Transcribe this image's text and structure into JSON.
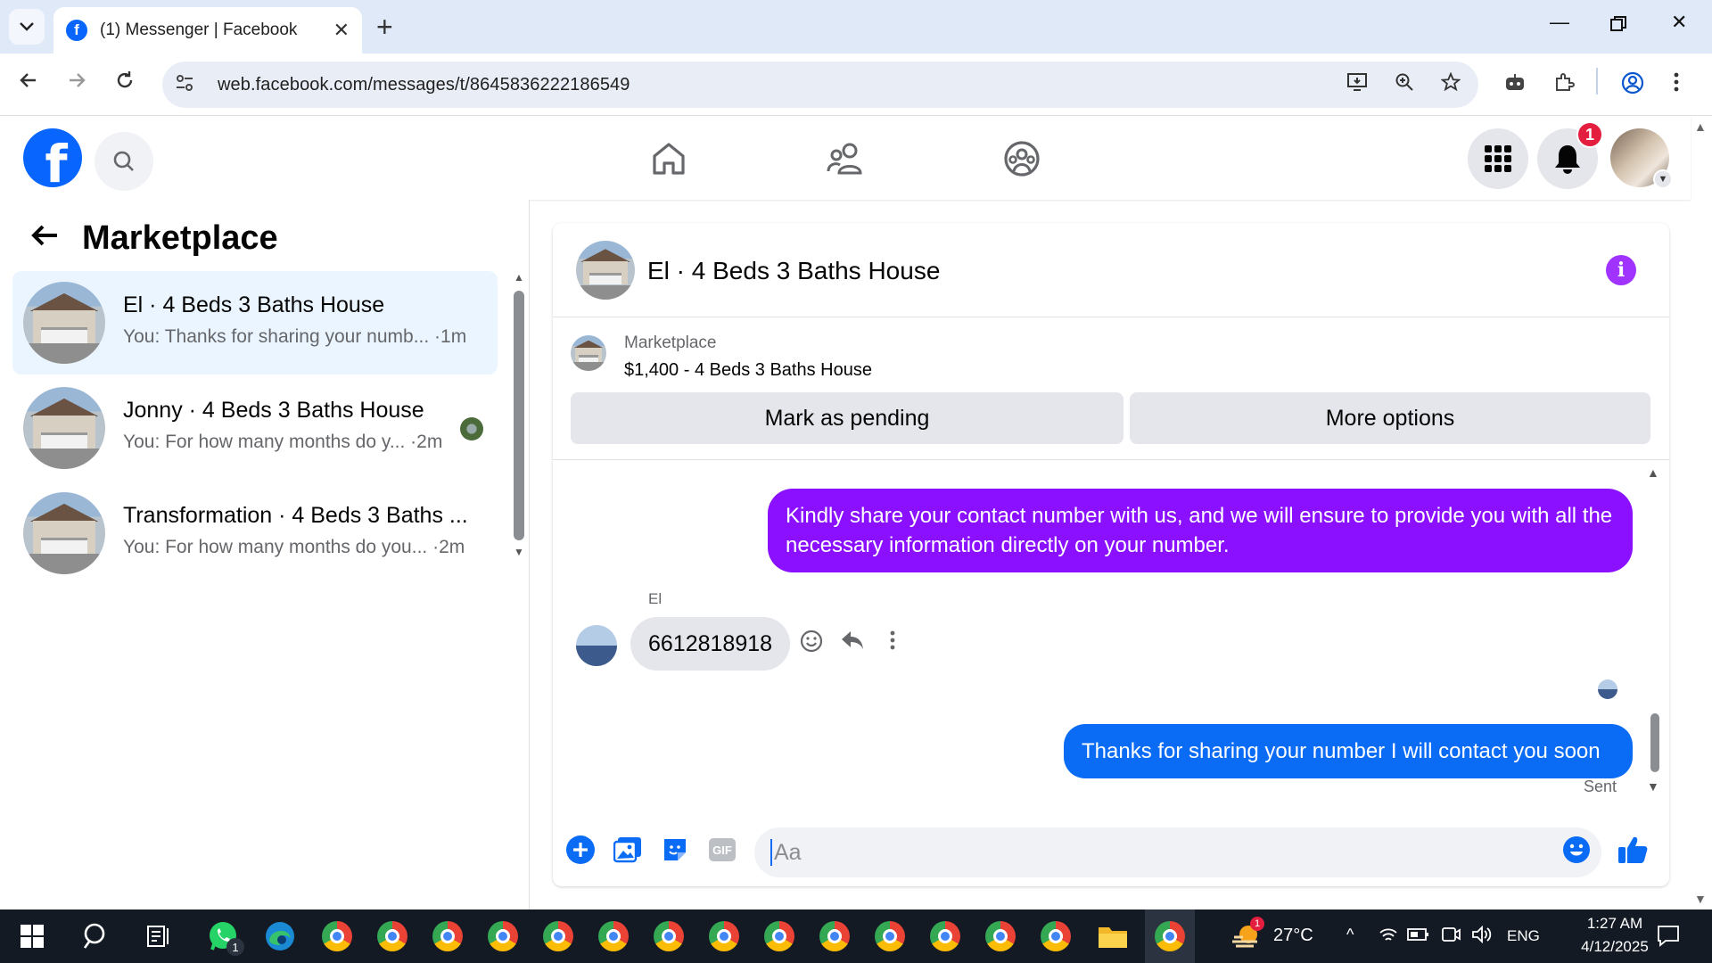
{
  "browser": {
    "tab_title": "(1) Messenger | Facebook",
    "favicon_letter": "f",
    "url": "web.facebook.com/messages/t/8645836222186549"
  },
  "fb_header": {
    "logo_letter": "f",
    "notifications_count": "1"
  },
  "sidebar": {
    "title": "Marketplace",
    "conversations": [
      {
        "name": "El · 4 Beds 3 Baths House",
        "preview": "You: Thanks for sharing your numb... ·1m",
        "active": true
      },
      {
        "name": "Jonny · 4 Beds 3 Baths House",
        "preview": "You: For how many months do y... ·2m",
        "active": false
      },
      {
        "name": "Transformation · 4 Beds 3 Baths ...",
        "preview": "You: For how many months do you... ·2m",
        "active": false
      }
    ]
  },
  "chat": {
    "title": "El · 4 Beds 3 Baths House",
    "listing": {
      "kind": "Marketplace",
      "title": "$1,400 - 4 Beds 3 Baths House",
      "mark_pending_label": "Mark as pending",
      "more_options_label": "More options"
    },
    "messages": [
      {
        "from": "me",
        "text": "Kindly share your contact number with us, and we will ensure to provide you with all the necessary information directly on your number."
      },
      {
        "from": "El",
        "sender_label": "El",
        "text": "6612818918"
      },
      {
        "from": "me",
        "text": "Thanks for sharing your number I will contact you soon"
      }
    ],
    "status": "Sent",
    "composer_placeholder": "Aa"
  },
  "taskbar": {
    "weather": "27°C",
    "weather_badge": "1",
    "whatsapp_badge": "1",
    "language": "ENG",
    "time": "1:27 AM",
    "date": "4/12/2025"
  },
  "colors": {
    "fb_blue": "#0866ff",
    "purple_bubble": "#8a10ff",
    "blue_bubble": "#0a6bf5",
    "active_row": "#ebf5ff"
  }
}
